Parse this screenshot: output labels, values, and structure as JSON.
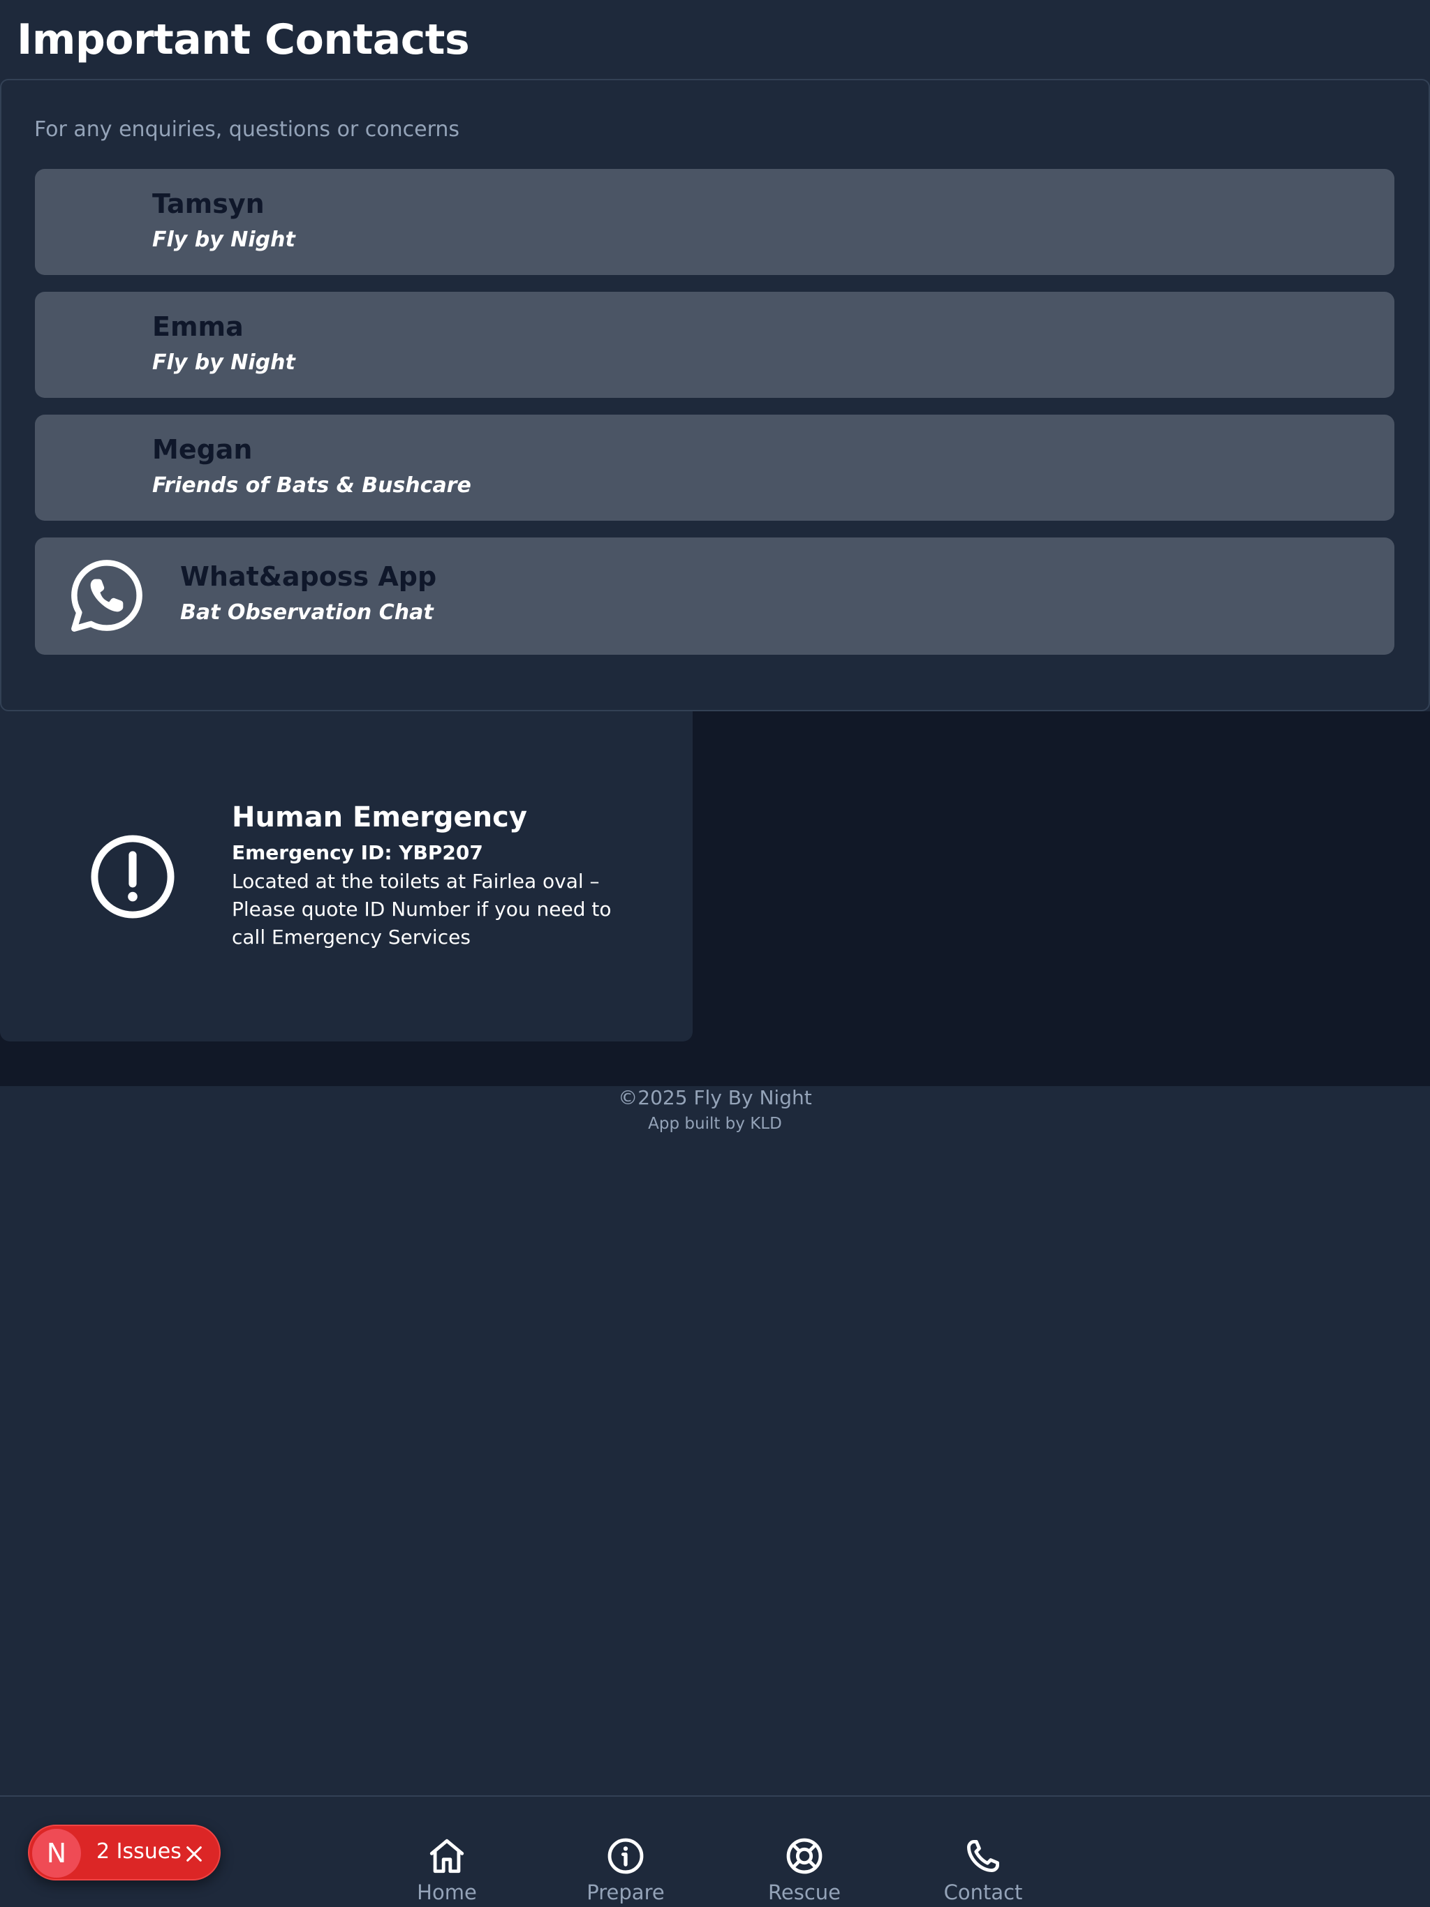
{
  "page": {
    "title": "Important Contacts"
  },
  "contacts": {
    "intro": "For any enquiries, questions or concerns",
    "items": [
      {
        "name": "Tamsyn",
        "org": "Fly by Night"
      },
      {
        "name": "Emma",
        "org": "Fly by Night"
      },
      {
        "name": "Megan",
        "org": "Friends of Bats & Bushcare"
      },
      {
        "name": "What&aposs App",
        "org": "Bat Observation Chat",
        "icon": "whatsapp-icon"
      }
    ]
  },
  "emergency": {
    "icon": "alert-circle-icon",
    "title": "Human Emergency",
    "id_line": "Emergency ID: YBP207",
    "description": "Located at the toilets at Fairlea oval – Please quote ID Number if you need to call Emergency Services"
  },
  "footer": {
    "copyright": "©2025 Fly By Night",
    "built_by": "App built by KLD"
  },
  "nav": {
    "items": [
      {
        "label": "Home",
        "icon": "home-icon"
      },
      {
        "label": "Prepare",
        "icon": "info-icon"
      },
      {
        "label": "Rescue",
        "icon": "lifebuoy-icon"
      },
      {
        "label": "Contact",
        "icon": "phone-icon"
      }
    ]
  },
  "issues_badge": {
    "logo": "N",
    "label": "2 Issues",
    "color": "#dc2626"
  }
}
